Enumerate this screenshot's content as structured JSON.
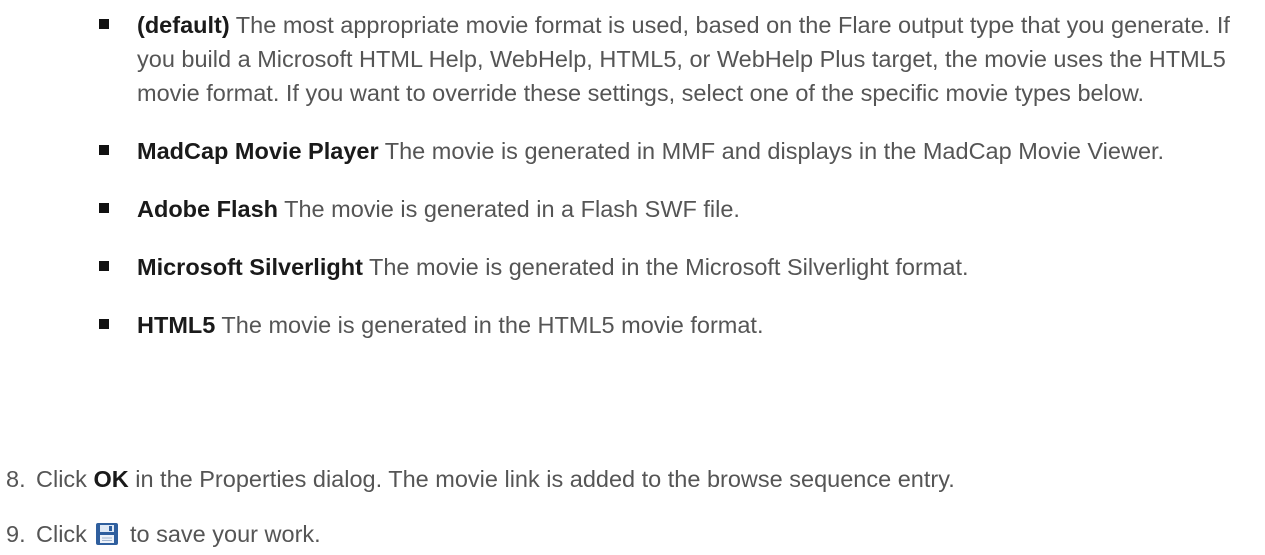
{
  "bullets": [
    {
      "term": "(default)",
      "text": " The most appropriate movie format is used, based on the Flare output type that you generate. If you build a Microsoft HTML Help, WebHelp, HTML5, or WebHelp Plus target, the movie uses the HTML5 movie format. If you want to override these settings, select one of the specific movie types below."
    },
    {
      "term": "MadCap Movie Player",
      "text": " The movie is generated in MMF and displays in the MadCap Movie Viewer."
    },
    {
      "term": "Adobe Flash",
      "text": " The movie is generated in a Flash SWF file."
    },
    {
      "term": "Microsoft Silverlight",
      "text": " The movie is generated in the Microsoft Silverlight format."
    },
    {
      "term": "HTML5",
      "text": " The movie is generated in the HTML5 movie format."
    }
  ],
  "steps": [
    {
      "number": "8.",
      "prefix": "Click ",
      "strong": "OK",
      "suffix": " in the Properties dialog. The movie link is added to the browse sequence entry."
    },
    {
      "number": "9.",
      "prefix": "Click ",
      "icon": "save-icon",
      "suffix": " to save your work."
    }
  ],
  "colors": {
    "body_text": "#555555",
    "term_text": "#1a1a1a",
    "bullet": "#111111",
    "save_icon": "#2f5f9e"
  }
}
